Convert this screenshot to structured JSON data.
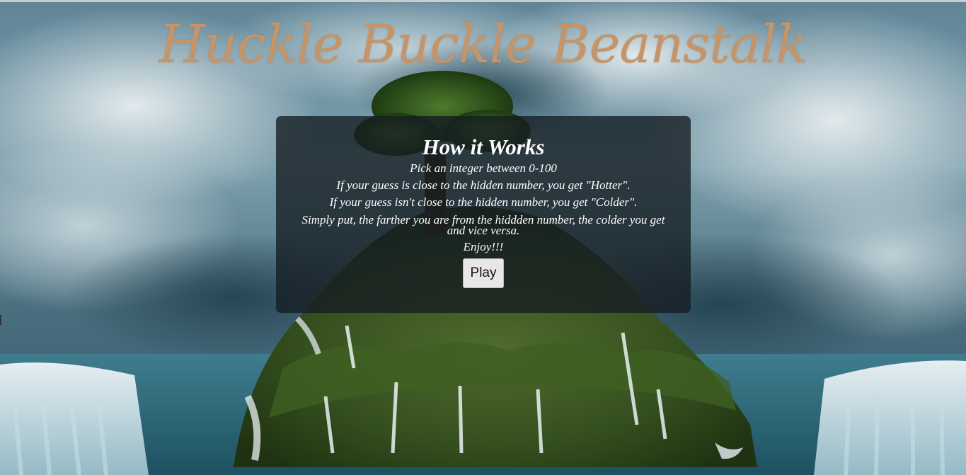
{
  "title": "Huckle Buckle Beanstalk",
  "instructions": {
    "heading": "How it Works",
    "lines": [
      "Pick an integer between 0-100",
      "If your guess is close to the hidden number, you get \"Hotter\".",
      "If your guess isn't close to the hidden number, you get \"Colder\".",
      "Simply put, the farther you are from the hiddden number, the colder you get and vice versa.",
      "Enjoy!!!"
    ]
  },
  "play_button": {
    "label": "Play"
  },
  "colors": {
    "title": "#c4956a",
    "panel_background": "#141c21",
    "button_background": "#e7e7e7"
  }
}
